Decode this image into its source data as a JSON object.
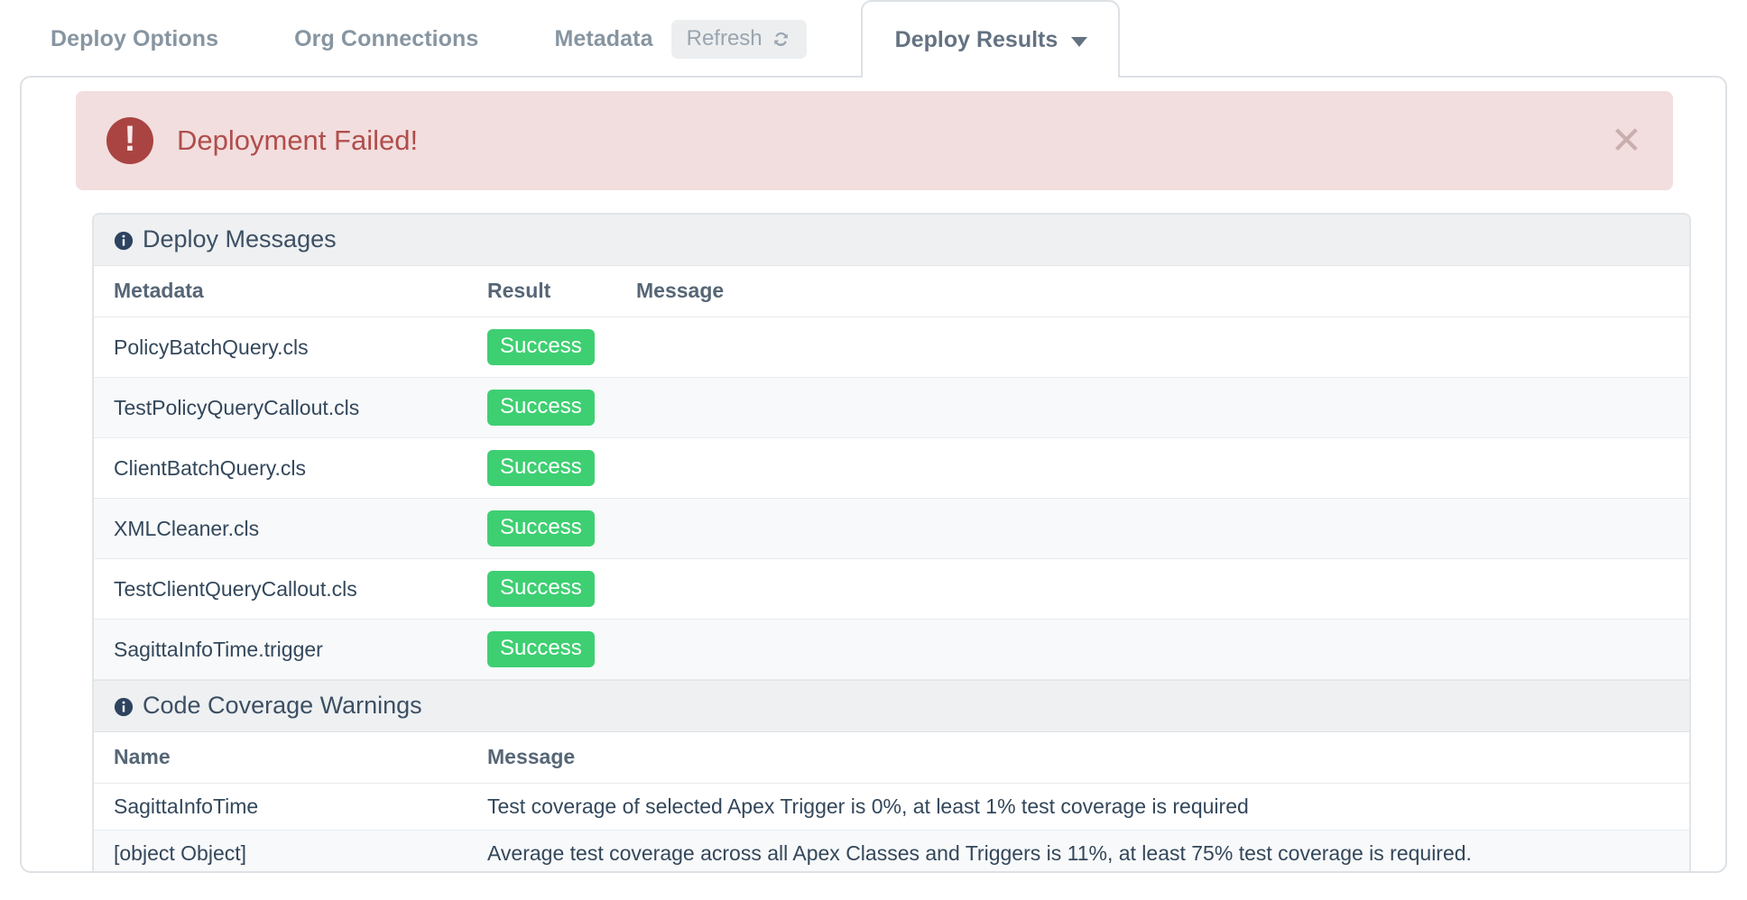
{
  "tabs": [
    {
      "label": "Deploy Options",
      "active": false
    },
    {
      "label": "Org Connections",
      "active": false
    },
    {
      "label": "Metadata",
      "active": false
    }
  ],
  "refresh": {
    "label": "Refresh",
    "icon": "refresh-icon"
  },
  "active_tab": {
    "label": "Deploy Results",
    "caret": "▼"
  },
  "alert": {
    "icon": "exclamation-circle-icon",
    "bang": "!",
    "message": "Deployment Failed!",
    "close": "✕",
    "bg_color": "#f2dede",
    "text_color": "#b04e4c",
    "icon_color": "#a94442"
  },
  "deploy_messages": {
    "section_title": "Deploy Messages",
    "section_icon": "info-circle-icon",
    "columns": [
      "Metadata",
      "Result",
      "Message"
    ],
    "rows": [
      {
        "metadata": "PolicyBatchQuery.cls",
        "result": "Success",
        "message": ""
      },
      {
        "metadata": "TestPolicyQueryCallout.cls",
        "result": "Success",
        "message": ""
      },
      {
        "metadata": "ClientBatchQuery.cls",
        "result": "Success",
        "message": ""
      },
      {
        "metadata": "XMLCleaner.cls",
        "result": "Success",
        "message": ""
      },
      {
        "metadata": "TestClientQueryCallout.cls",
        "result": "Success",
        "message": ""
      },
      {
        "metadata": "SagittaInfoTime.trigger",
        "result": "Success",
        "message": ""
      }
    ]
  },
  "code_coverage_warnings": {
    "section_title": "Code Coverage Warnings",
    "section_icon": "info-circle-icon",
    "columns": [
      "Name",
      "Message"
    ],
    "rows": [
      {
        "name": "SagittaInfoTime",
        "message": "Test coverage of selected Apex Trigger is 0%, at least 1% test coverage is required"
      },
      {
        "name": "[object Object]",
        "message": "Average test coverage across all Apex Classes and Triggers is 11%, at least 75% test coverage is required."
      }
    ]
  },
  "colors": {
    "success_badge": "#3ecf72",
    "tab_inactive": "#8795a1",
    "tab_active": "#647282",
    "section_header_bg": "#eef0f2",
    "card_border": "#dde1e5"
  }
}
